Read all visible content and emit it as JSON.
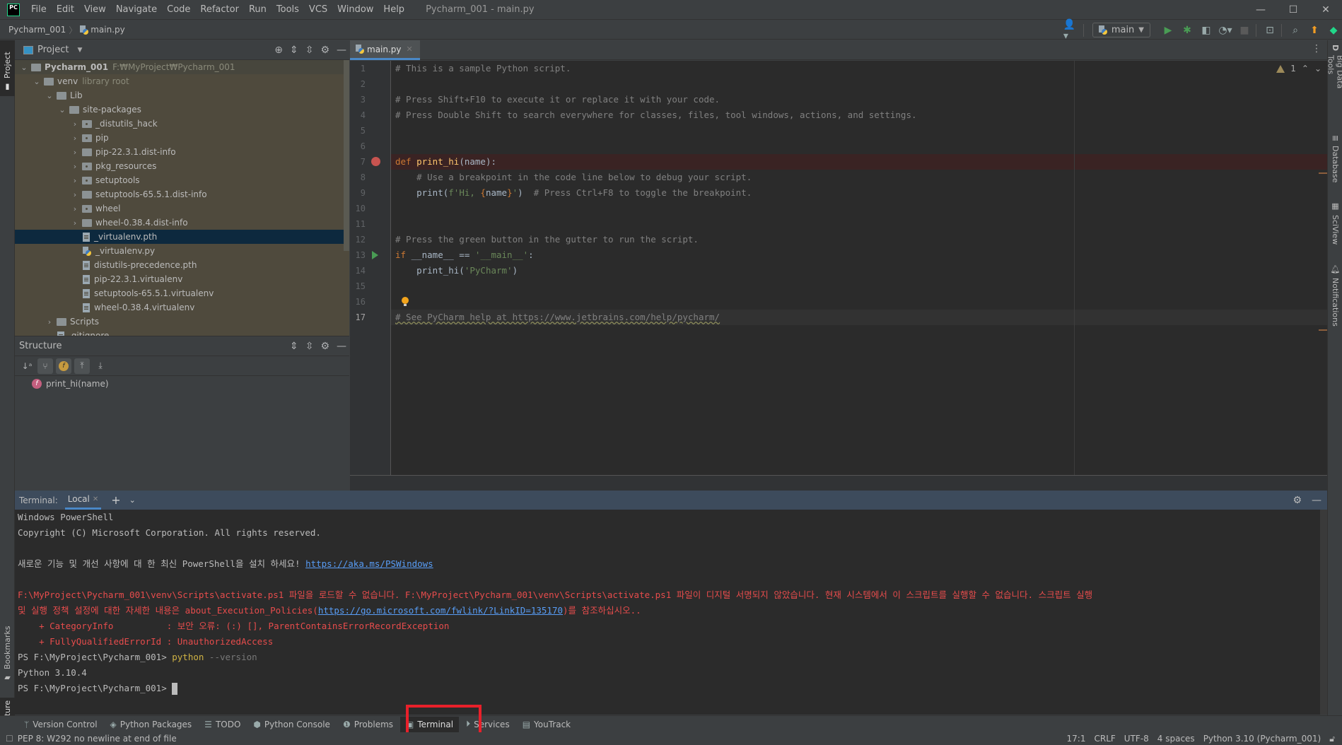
{
  "menubar": {
    "logo": "PC",
    "items": [
      "File",
      "Edit",
      "View",
      "Navigate",
      "Code",
      "Refactor",
      "Run",
      "Tools",
      "VCS",
      "Window",
      "Help"
    ],
    "window_title": "Pycharm_001 - main.py",
    "controls": {
      "minimize": "—",
      "maximize": "☐",
      "close": "✕"
    }
  },
  "navbar": {
    "breadcrumb": [
      "Pycharm_001",
      "main.py"
    ],
    "run_config": "main",
    "icons": [
      "user-icon",
      "run-icon",
      "debug-icon",
      "coverage-icon",
      "profile-icon",
      "stop-icon",
      "terminal-icon",
      "search-icon",
      "update-icon",
      "toolbox-icon"
    ]
  },
  "left_stripe": {
    "project_tab": "Project",
    "bookmarks_tab": "Bookmarks",
    "structure_tab": "Structure"
  },
  "project_panel": {
    "title": "Project",
    "tree": [
      {
        "label": "Pycharm_001",
        "hint": "F:₩MyProject₩Pycharm_001",
        "depth": 0,
        "type": "folder",
        "expanded": true,
        "root": true
      },
      {
        "label": "venv",
        "hint": "library root",
        "depth": 1,
        "type": "folder",
        "expanded": true
      },
      {
        "label": "Lib",
        "depth": 2,
        "type": "folder",
        "expanded": true
      },
      {
        "label": "site-packages",
        "depth": 3,
        "type": "folder",
        "expanded": true
      },
      {
        "label": "_distutils_hack",
        "depth": 4,
        "type": "package",
        "expanded": false
      },
      {
        "label": "pip",
        "depth": 4,
        "type": "package",
        "expanded": false
      },
      {
        "label": "pip-22.3.1.dist-info",
        "depth": 4,
        "type": "folder",
        "expanded": false
      },
      {
        "label": "pkg_resources",
        "depth": 4,
        "type": "package",
        "expanded": false
      },
      {
        "label": "setuptools",
        "depth": 4,
        "type": "package",
        "expanded": false
      },
      {
        "label": "setuptools-65.5.1.dist-info",
        "depth": 4,
        "type": "folder",
        "expanded": false
      },
      {
        "label": "wheel",
        "depth": 4,
        "type": "package",
        "expanded": false
      },
      {
        "label": "wheel-0.38.4.dist-info",
        "depth": 4,
        "type": "folder",
        "expanded": false
      },
      {
        "label": "_virtualenv.pth",
        "depth": 4,
        "type": "file",
        "selected": true
      },
      {
        "label": "_virtualenv.py",
        "depth": 4,
        "type": "python"
      },
      {
        "label": "distutils-precedence.pth",
        "depth": 4,
        "type": "file"
      },
      {
        "label": "pip-22.3.1.virtualenv",
        "depth": 4,
        "type": "file"
      },
      {
        "label": "setuptools-65.5.1.virtualenv",
        "depth": 4,
        "type": "file"
      },
      {
        "label": "wheel-0.38.4.virtualenv",
        "depth": 4,
        "type": "file"
      },
      {
        "label": "Scripts",
        "depth": 2,
        "type": "folder",
        "expanded": false
      },
      {
        "label": ".gitignore",
        "depth": 2,
        "type": "file"
      }
    ]
  },
  "structure_panel": {
    "title": "Structure",
    "items": [
      {
        "label": "print_hi(name)",
        "kind": "f"
      }
    ]
  },
  "editor": {
    "tab": "main.py",
    "warning_count": "1",
    "lines": [
      {
        "n": 1,
        "parts": [
          {
            "t": "# This is a sample Python script.",
            "c": "comment"
          }
        ]
      },
      {
        "n": 2,
        "parts": []
      },
      {
        "n": 3,
        "parts": [
          {
            "t": "# Press Shift+F10 to execute it or replace it with your code.",
            "c": "comment"
          }
        ]
      },
      {
        "n": 4,
        "parts": [
          {
            "t": "# Press Double Shift to search everywhere for classes, files, tool windows, actions, and settings.",
            "c": "comment"
          }
        ]
      },
      {
        "n": 5,
        "parts": []
      },
      {
        "n": 6,
        "parts": []
      },
      {
        "n": 7,
        "parts": [
          {
            "t": "def ",
            "c": "kw"
          },
          {
            "t": "print_hi",
            "c": "fn"
          },
          {
            "t": "(name):",
            "c": ""
          }
        ]
      },
      {
        "n": 8,
        "parts": [
          {
            "t": "    # Use a breakpoint in the code line below to debug your script.",
            "c": "comment"
          }
        ]
      },
      {
        "n": 9,
        "parts": [
          {
            "t": "    print(",
            "c": ""
          },
          {
            "t": "f'Hi, ",
            "c": "str"
          },
          {
            "t": "{",
            "c": "brace"
          },
          {
            "t": "name",
            "c": ""
          },
          {
            "t": "}",
            "c": "brace"
          },
          {
            "t": "'",
            "c": "str"
          },
          {
            "t": ")  ",
            "c": ""
          },
          {
            "t": "# Press Ctrl+F8 to toggle the breakpoint.",
            "c": "comment"
          }
        ]
      },
      {
        "n": 10,
        "parts": []
      },
      {
        "n": 11,
        "parts": []
      },
      {
        "n": 12,
        "parts": [
          {
            "t": "# Press the green button in the gutter to run the script.",
            "c": "comment"
          }
        ]
      },
      {
        "n": 13,
        "parts": [
          {
            "t": "if ",
            "c": "kw"
          },
          {
            "t": "__name__ == ",
            "c": ""
          },
          {
            "t": "'__main__'",
            "c": "str"
          },
          {
            "t": ":",
            "c": ""
          }
        ]
      },
      {
        "n": 14,
        "parts": [
          {
            "t": "    print_hi(",
            "c": ""
          },
          {
            "t": "'PyCharm'",
            "c": "str"
          },
          {
            "t": ")",
            "c": ""
          }
        ]
      },
      {
        "n": 15,
        "parts": []
      },
      {
        "n": 16,
        "parts": []
      },
      {
        "n": 17,
        "parts": [
          {
            "t": "# See PyCharm help at https://www.jetbrains.com/help/pycharm/",
            "c": "comment"
          }
        ]
      }
    ],
    "breakpoint_line": 7,
    "run_gutter_line": 13,
    "bulb_line": 16,
    "current_line": 17
  },
  "right_stripe": [
    "Big Data Tools",
    "Database",
    "SciView",
    "Notifications"
  ],
  "terminal": {
    "label": "Terminal:",
    "tab": "Local",
    "lines": [
      {
        "parts": [
          {
            "t": "Windows PowerShell",
            "c": ""
          }
        ]
      },
      {
        "parts": [
          {
            "t": "Copyright (C) Microsoft Corporation. All rights reserved.",
            "c": ""
          }
        ]
      },
      {
        "parts": []
      },
      {
        "parts": [
          {
            "t": "새로운 기능 및 개선 사항에 대 한 최신 PowerShell을 설치 하세요! ",
            "c": ""
          },
          {
            "t": "https://aka.ms/PSWindows",
            "c": "link"
          }
        ]
      },
      {
        "parts": []
      },
      {
        "parts": [
          {
            "t": "F:\\MyProject\\Pycharm_001\\venv\\Scripts\\activate.ps1 파일을 로드할 수 없습니다. F:\\MyProject\\Pycharm_001\\venv\\Scripts\\activate.ps1 파일이 디지털 서명되지 않았습니다. 현재 시스템에서 이 스크립트를 실행할 수 없습니다. 스크립트 실행",
            "c": "red"
          }
        ]
      },
      {
        "parts": [
          {
            "t": "및 실행 정책 설정에 대한 자세한 내용은 about_Execution_Policies(",
            "c": "red"
          },
          {
            "t": "https://go.microsoft.com/fwlink/?LinkID=135170",
            "c": "link"
          },
          {
            "t": ")를 참조하십시오..",
            "c": "red"
          }
        ]
      },
      {
        "parts": [
          {
            "t": "    + CategoryInfo          : 보안 오류: (:) [], ParentContainsErrorRecordException",
            "c": "red"
          }
        ]
      },
      {
        "parts": [
          {
            "t": "    + FullyQualifiedErrorId : UnauthorizedAccess",
            "c": "red"
          }
        ]
      },
      {
        "parts": [
          {
            "t": "PS F:\\MyProject\\Pycharm_001> ",
            "c": ""
          },
          {
            "t": "python",
            "c": "yellow"
          },
          {
            "t": " --version",
            "c": "dim"
          }
        ]
      },
      {
        "parts": [
          {
            "t": "Python 3.10.4",
            "c": ""
          }
        ]
      },
      {
        "parts": [
          {
            "t": "PS F:\\MyProject\\Pycharm_001> ",
            "c": ""
          }
        ],
        "cursor": true
      }
    ]
  },
  "toolwindows": [
    {
      "label": "Version Control",
      "icon": "vcs-icon",
      "glyph": "ᛘ"
    },
    {
      "label": "Python Packages",
      "icon": "packages-icon",
      "glyph": "◈"
    },
    {
      "label": "TODO",
      "icon": "todo-icon",
      "glyph": "☰"
    },
    {
      "label": "Python Console",
      "icon": "python-console-icon",
      "glyph": "⬢"
    },
    {
      "label": "Problems",
      "icon": "problems-icon",
      "glyph": "❶"
    },
    {
      "label": "Terminal",
      "icon": "terminal-icon",
      "glyph": "▣",
      "active": true
    },
    {
      "label": "Services",
      "icon": "services-icon",
      "glyph": "⏵"
    },
    {
      "label": "YouTrack",
      "icon": "youtrack-icon",
      "glyph": "▤"
    }
  ],
  "statusbar": {
    "message": "PEP 8: W292 no newline at end of file",
    "position": "17:1",
    "line_sep": "CRLF",
    "encoding": "UTF-8",
    "indent": "4 spaces",
    "interpreter": "Python 3.10 (Pycharm_001)"
  },
  "colors": {
    "highlight_box": "#e8202a",
    "accent": "#4a88c7",
    "selection": "#0d293e",
    "error_text": "#e74c4c",
    "link": "#589df6"
  }
}
